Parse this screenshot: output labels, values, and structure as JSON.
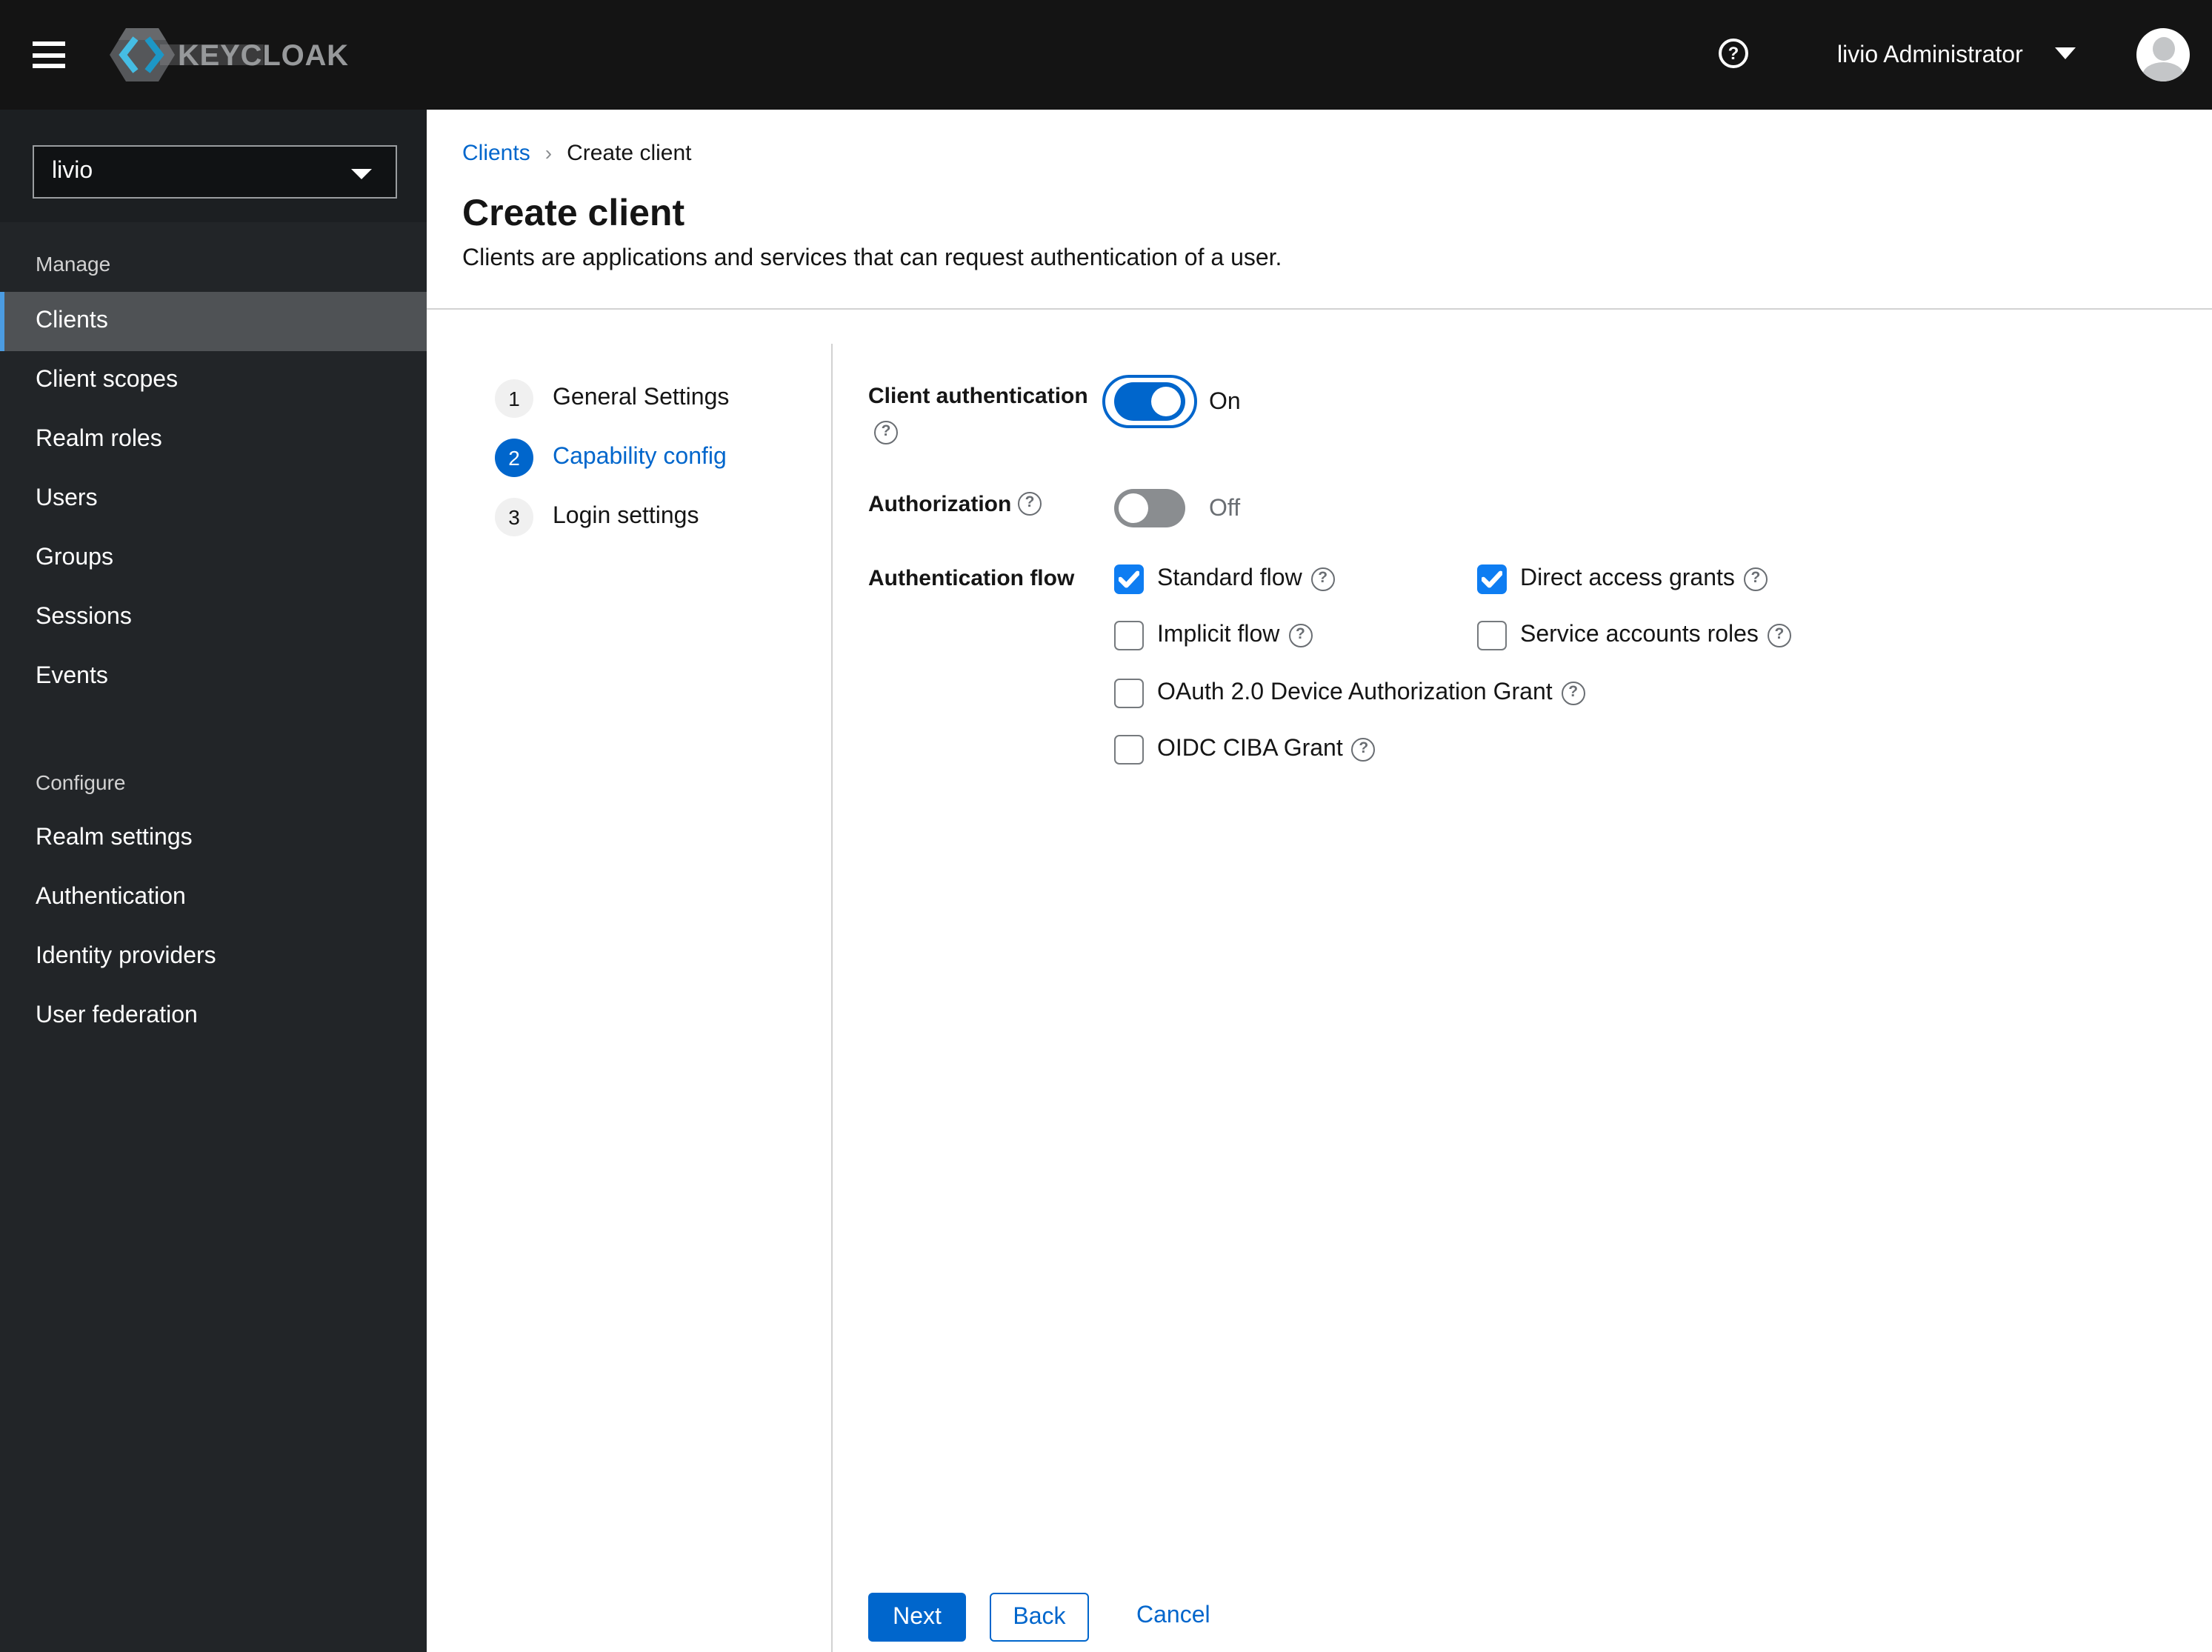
{
  "header": {
    "brand": "KEYCLOAK",
    "help": "?",
    "user": "livio Administrator"
  },
  "sidebar": {
    "realm": "livio",
    "sections": [
      {
        "label": "Manage",
        "items": [
          "Clients",
          "Client scopes",
          "Realm roles",
          "Users",
          "Groups",
          "Sessions",
          "Events"
        ]
      },
      {
        "label": "Configure",
        "items": [
          "Realm settings",
          "Authentication",
          "Identity providers",
          "User federation"
        ]
      }
    ],
    "selected": "Clients"
  },
  "breadcrumb": {
    "items": [
      "Clients",
      "Create client"
    ]
  },
  "page": {
    "title": "Create client",
    "description": "Clients are applications and services that can request authentication of a user."
  },
  "wizard": {
    "steps": [
      {
        "num": "1",
        "label": "General Settings",
        "active": false
      },
      {
        "num": "2",
        "label": "Capability config",
        "active": true
      },
      {
        "num": "3",
        "label": "Login settings",
        "active": false
      }
    ]
  },
  "form": {
    "client_authentication": {
      "label": "Client authentication",
      "state": "On",
      "enabled": true
    },
    "authorization": {
      "label": "Authorization",
      "state": "Off",
      "enabled": false
    },
    "authentication_flow": {
      "label": "Authentication flow",
      "options": [
        {
          "label": "Standard flow",
          "checked": true
        },
        {
          "label": "Direct access grants",
          "checked": true
        },
        {
          "label": "Implicit flow",
          "checked": false
        },
        {
          "label": "Service accounts roles",
          "checked": false
        },
        {
          "label": "OAuth 2.0 Device Authorization Grant",
          "checked": false
        },
        {
          "label": "OIDC CIBA Grant",
          "checked": false
        }
      ]
    }
  },
  "actions": {
    "next": "Next",
    "back": "Back",
    "cancel": "Cancel"
  },
  "colors": {
    "primary": "#0066cc",
    "checkbox_checked": "#0e7df2",
    "masthead_bg": "#141414",
    "sidebar_bg": "#222528",
    "selected_item_bg": "#4f5255",
    "divider": "#d2d2d2"
  }
}
